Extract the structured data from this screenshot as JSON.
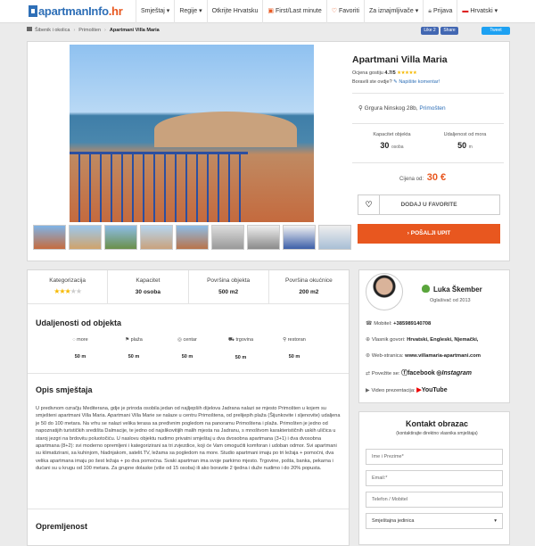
{
  "brand": {
    "logo_main": "apartmanInfo",
    "logo_tld": ".hr"
  },
  "nav": {
    "items": [
      {
        "label": "Smještaj ▾"
      },
      {
        "label": "Regije ▾"
      },
      {
        "label": "Otkrijte Hrvatsku"
      },
      {
        "label": "First/Last minute"
      },
      {
        "label": "Favoriti"
      },
      {
        "label": "Za iznajmljivače ▾"
      },
      {
        "label": "Prijava"
      },
      {
        "label": "Hrvatski ▾"
      }
    ]
  },
  "breadcrumb": [
    "Šibenik i okolica",
    "Primošten",
    "Apartmani Villa Maria"
  ],
  "share": {
    "like": "Like 2",
    "share": "Share",
    "tweet": "Tweet"
  },
  "listing": {
    "title": "Apartmani Villa Maria",
    "rating_label": "Ocjena gostiju",
    "rating_value": "4.7/5",
    "stayed_question": "Boravili ste ovdje?",
    "write_comment": "Napišite komentar!",
    "address": "Grgura Ninskog 28b,",
    "city": "Primošten",
    "capacity_label": "Kapacitet objekta",
    "capacity_value": "30",
    "capacity_unit": "osoba",
    "sea_label": "Udaljenost od mora",
    "sea_value": "50",
    "sea_unit": "m",
    "price_label": "Cijena od:",
    "price_value": "30 €",
    "fav_button": "DODAJ U FAVORITE",
    "send_button": "POŠALJI UPIT"
  },
  "tabs": [
    {
      "label": "Kategorizacija",
      "value": "",
      "stars_filled": 3,
      "stars_total": 5
    },
    {
      "label": "Kapacitet",
      "value": "30 osoba"
    },
    {
      "label": "Površina objekta",
      "value": "500 m2"
    },
    {
      "label": "Površina okućnice",
      "value": "200 m2"
    }
  ],
  "distances": {
    "title": "Udaljenosti od objekta",
    "items": [
      {
        "icon": "wave-icon",
        "label": "more",
        "value": "50 m"
      },
      {
        "icon": "flag-icon",
        "label": "plaža",
        "value": "50 m"
      },
      {
        "icon": "target-icon",
        "label": "centar",
        "value": "50 m"
      },
      {
        "icon": "cart-icon",
        "label": "trgovina",
        "value": "50 m"
      },
      {
        "icon": "restaurant-icon",
        "label": "restoran",
        "value": "50 m"
      }
    ]
  },
  "description": {
    "title": "Opis smještaja",
    "text": "U predivnom ozračju Mediterana, gdje je priroda osobila jedan od najljepših dijelova Jadrana nalazi se mjesto Primošten u kojem su smješteni apartmani Villa Maria. Apartmani Villa Marie se nalaze u centru Primoštena, od prelijepih plaža (Šijunkovite i sljenovite) udaljena je 50 do 100 metara. Na vrhu se nalazi velika terasa sa predivnim pogledom na panoramu Primoštena i plaža. Primošten je jedno od napoznatijih turističkih središta Dalmacije, te jedno od najslikovitijih malih mjesta na Jadranu, s mnoštvom karakterističnih uskih uličica u staroj jezgri na brdovitu poluotočiću. U naslovu objektu nudimo privatni smještaj u dva dvosobna apartmana (3+1) i dva dvosobna apartmana (8+2): svi moderno opremljeni i kategorizirani sa tri zvjezdice, koji će Vam omogućiti komforan i udoban odmor. Svi apartmani su klimatizirani, sa kuhinjom, hladnjakom, satelit.TV, ležama sa pogledom na more. Studio apartmani imaju po tri ležaja + pomoćni, dva velika apartmana imaju po šest ležaja + po dva pomoćna. Svaki apartman ima svoje parkirno mjesto. Trgovine, pošta, banka, pekarna i dućani su u krugu od 100 metara. Za grupne dolaske (više od 15 osoba) ili ako boravite 2 tjedna i duže nudimo i do 20% popusta."
  },
  "equipment_title": "Opremljenost",
  "host": {
    "name": "Luka Škember",
    "since": "Oglašivač od 2013",
    "mobile_label": "Mobitel:",
    "mobile": "+385989140708",
    "languages_label": "Vlasnik govori:",
    "languages": "Hrvatski, Engleski, Njemački,",
    "web_label": "Web-stranica:",
    "web": "www.villamaria-apartmani.com",
    "connect_label": "Povežite se:",
    "facebook": "facebook",
    "instagram": "Instagram",
    "video_label": "Video prezentacija:",
    "youtube": "YouTube"
  },
  "contact": {
    "title": "Kontakt obrazac",
    "subtitle": "(kontaktirajte direktno vlasnika smještaja)",
    "name_placeholder": "Ime i Prezime*",
    "email_placeholder": "Email:*",
    "phone_placeholder": "Telefon / Mobitel",
    "unit_select": "Smještajna jedinica"
  },
  "colors": {
    "accent": "#e8571f",
    "brand": "#2e6fb7"
  }
}
